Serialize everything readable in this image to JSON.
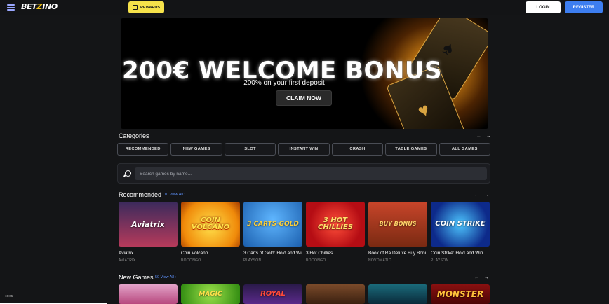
{
  "header": {
    "logo_text_a": "BET",
    "logo_text_b": "Z",
    "logo_text_c": "INO",
    "rewards_label": "REWARDS",
    "login_label": "LOGIN",
    "register_label": "REGISTER"
  },
  "banner": {
    "title": "200€ WELCOME BONUS",
    "subtitle": "200% on your first deposit",
    "cta_label": "CLAIM NOW"
  },
  "categories": {
    "title": "Categories",
    "items": [
      "RECOMMENDED",
      "NEW GAMES",
      "SLOT",
      "INSTANT WIN",
      "CRASH",
      "TABLE GAMES",
      "ALL GAMES"
    ]
  },
  "search": {
    "placeholder": "Search games by name..."
  },
  "recommended": {
    "title": "Recommended",
    "view_all": "10 View All",
    "games": [
      {
        "name": "Aviatrix",
        "provider": "AVIATRIX",
        "thumb_text": "Aviatrix"
      },
      {
        "name": "Coin Volcano",
        "provider": "BOOONGO",
        "thumb_text": "COIN VOLCANO"
      },
      {
        "name": "3 Carts of Gold: Hold and Win",
        "provider": "PLAYSON",
        "thumb_text": "3 CARTS·GOLD"
      },
      {
        "name": "3 Hot Chillies",
        "provider": "BOOONGO",
        "thumb_text": "3 HOT CHILLIES"
      },
      {
        "name": "Book of Ra Deluxe Buy Bonus",
        "provider": "NOVOMATIC",
        "thumb_text": "BUY BONUS"
      },
      {
        "name": "Coin Strike: Hold and Win",
        "provider": "PLAYSON",
        "thumb_text": "COIN STRIKE"
      }
    ]
  },
  "new_games": {
    "title": "New Games",
    "view_all": "50 View All",
    "thumbs": [
      "",
      "MAGIC",
      "ROYAL",
      "",
      "",
      "MONSTER"
    ]
  },
  "status": {
    "clock": "15:05"
  },
  "colors": {
    "background": "#141517",
    "accent_blue": "#3d7ef0",
    "rewards_yellow": "#f6e24a"
  }
}
